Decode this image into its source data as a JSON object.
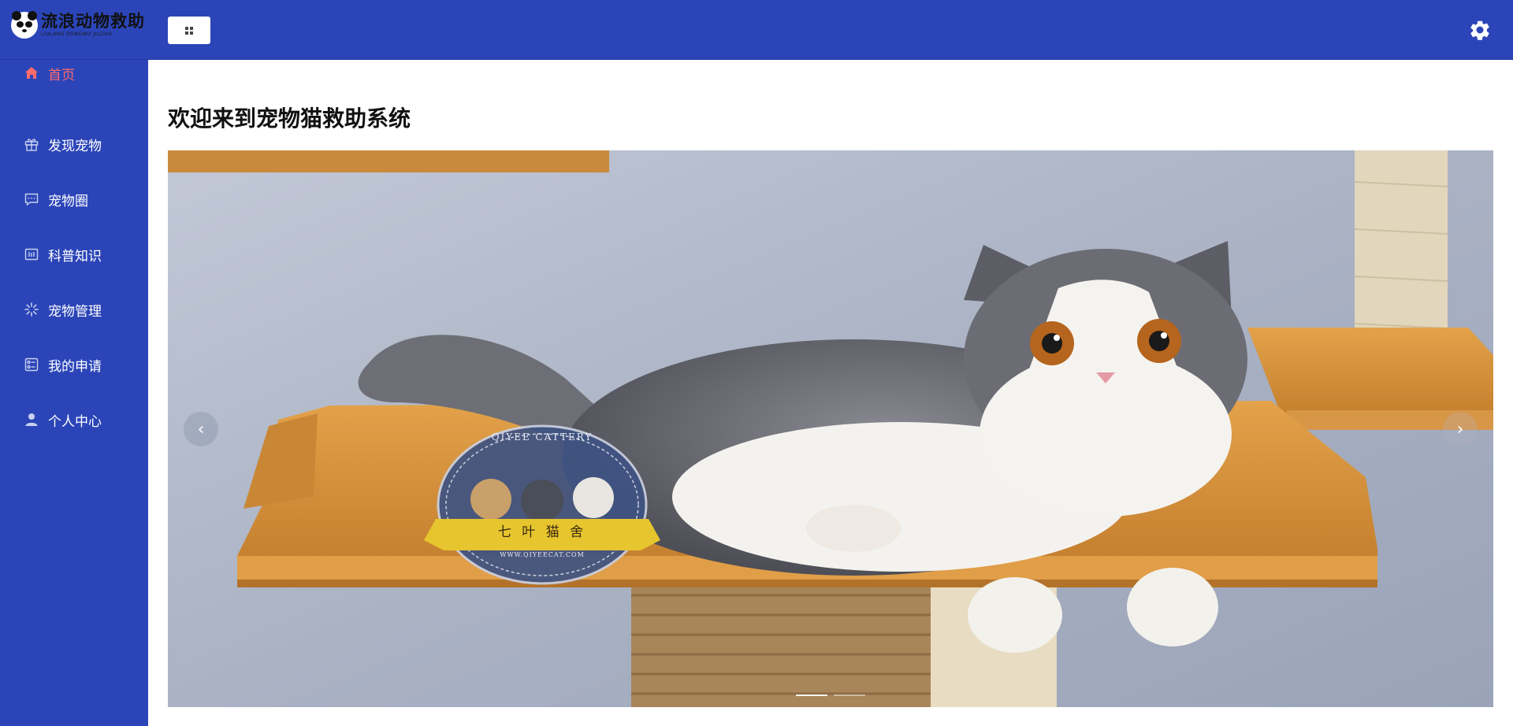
{
  "app": {
    "logo_title": "流浪动物救助",
    "logo_subtitle": "LIULANG DONGWU JIUZHU"
  },
  "header": {
    "menu_icon": "grid-icon",
    "settings_icon": "gear-icon"
  },
  "sidebar": {
    "items": [
      {
        "label": "首页",
        "icon": "home-icon",
        "active": true
      },
      {
        "label": "发现宠物",
        "icon": "gift-icon",
        "active": false
      },
      {
        "label": "宠物圈",
        "icon": "chat-icon",
        "active": false
      },
      {
        "label": "科普知识",
        "icon": "book-icon",
        "active": false
      },
      {
        "label": "宠物管理",
        "icon": "loading-icon",
        "active": false
      },
      {
        "label": "我的申请",
        "icon": "form-icon",
        "active": false
      },
      {
        "label": "个人中心",
        "icon": "user-icon",
        "active": false
      }
    ]
  },
  "main": {
    "title": "欢迎来到宠物猫救助系统",
    "carousel": {
      "prev_symbol": "‹",
      "next_symbol": "›",
      "slide_count": 2,
      "active_index": 0,
      "watermark_top": "QIYEE CATTERY",
      "watermark_banner": "七 叶 猫 舍",
      "watermark_url": "WWW.QIYEECAT.COM"
    }
  },
  "colors": {
    "brand_blue": "#2b45b8",
    "active_red": "#ff6b6b"
  }
}
